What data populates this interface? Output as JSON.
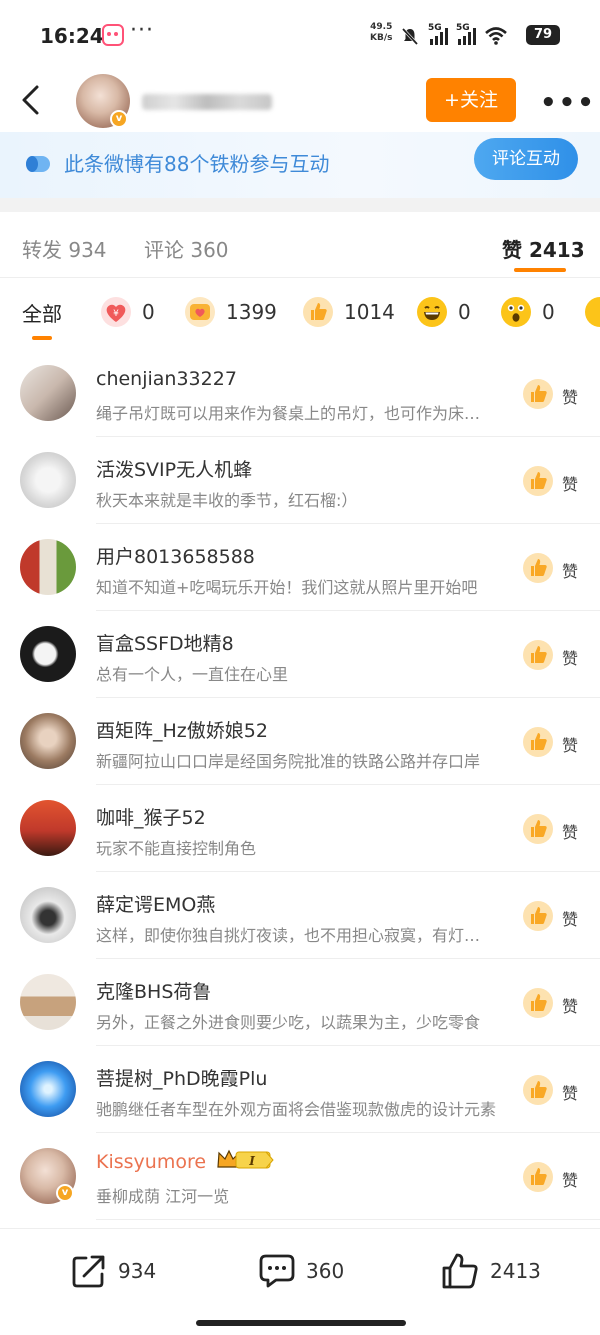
{
  "status_bar": {
    "time": "16:24",
    "net_speed_value": "49.5",
    "net_speed_unit": "KB/s",
    "sim1": "5G",
    "sim2": "5G",
    "battery": "79"
  },
  "header": {
    "follow_label": "+关注",
    "more_label": "•••"
  },
  "banner": {
    "text": "此条微博有88个铁粉参与互动",
    "button_label": "评论互动"
  },
  "tabs": [
    {
      "label": "转发 934"
    },
    {
      "label": "评论 360"
    },
    {
      "label": "赞 2413"
    }
  ],
  "reactions": {
    "all_label": "全部",
    "items": [
      {
        "icon": "heart-money-icon",
        "count": "0",
        "color": "#f05a5a"
      },
      {
        "icon": "heart-card-icon",
        "count": "1399",
        "color": "#f9b233"
      },
      {
        "icon": "thumbs-up-icon",
        "count": "1014",
        "color": "#f9a825"
      },
      {
        "icon": "laughing-face-icon",
        "count": "0",
        "color": "#fcc419"
      },
      {
        "icon": "surprised-face-icon",
        "count": "0",
        "color": "#fcc419"
      }
    ]
  },
  "likers": [
    {
      "name": "chenjian33227",
      "comment": "绳子吊灯既可以用来作为餐桌上的吊灯，也可作为床头灯。",
      "like_label": "赞",
      "avatar": "linear-gradient(135deg,#e9e4df,#c9b8ad 50%,#6b5a52)"
    },
    {
      "name": "活泼SVIP无人机蜂",
      "comment": "秋天本来就是丰收的季节，红石榴:）",
      "like_label": "赞",
      "avatar": "radial-gradient(circle,#f5f5f5 30%,#d9d9d9 60%,#bbb)"
    },
    {
      "name": "用户8013658588",
      "comment": "知道不知道+吃喝玩乐开始！我们这就从照片里开始吧",
      "like_label": "赞",
      "avatar": "linear-gradient(90deg,#c0392b 0 35%,#e8e1d4 35% 65%,#6a9a3c 65%)"
    },
    {
      "name": "盲盒SSFD地精8",
      "comment": "总有一个人，一直住在心里",
      "like_label": "赞",
      "avatar": "radial-gradient(circle at 45% 50%,#f4f4f4 25%,#1b1b1b 32%)"
    },
    {
      "name": "酉矩阵_Hz傲娇娘52",
      "comment": "新疆阿拉山口口岸是经国务院批准的铁路公路并存口岸",
      "like_label": "赞",
      "avatar": "radial-gradient(circle at 50% 45%,#e8d2c0 20%,#9c7b62 55%,#4a3a30)"
    },
    {
      "name": "咖啡_猴子52",
      "comment": "玩家不能直接控制角色",
      "like_label": "赞",
      "avatar": "linear-gradient(180deg,#e2542f,#c0392b 55%,#3b1a12)"
    },
    {
      "name": "薛定谔EMO燕",
      "comment": "这样，即使你独自挑灯夜读，也不用担心寂寞，有灯陪着你",
      "like_label": "赞",
      "avatar": "radial-gradient(circle at 50% 55%,#333 18%,#e9e9e9 40%,#b7b7b7)"
    },
    {
      "name": "克隆BHS荷鲁",
      "comment": "另外，正餐之外进食则要少吃，以蔬果为主，少吃零食",
      "like_label": "赞",
      "avatar": "linear-gradient(180deg,#efe8e0 0 40%,#c7a27d 40% 75%,#e8e1d8 75%)"
    },
    {
      "name": "菩提树_PhD晚霞Plu",
      "comment": "驰鹏继任者车型在外观方面将会借鉴现款傲虎的设计元素",
      "like_label": "赞",
      "avatar": "radial-gradient(circle at 50% 50%,#dff3ff 10%,#3e9cf2 45%,#0b3c8f)"
    },
    {
      "name": "Kissyumore",
      "comment": "垂柳成荫 江河一览",
      "like_label": "赞",
      "vip": true,
      "avatar": "radial-gradient(circle at 45% 40%,#f3e0d5 0%,#d8b9a6 40%,#a77c69 75%,#7d5a4c 100%)"
    }
  ],
  "bottom_bar": {
    "repost_count": "934",
    "comment_count": "360",
    "like_count": "2413"
  }
}
